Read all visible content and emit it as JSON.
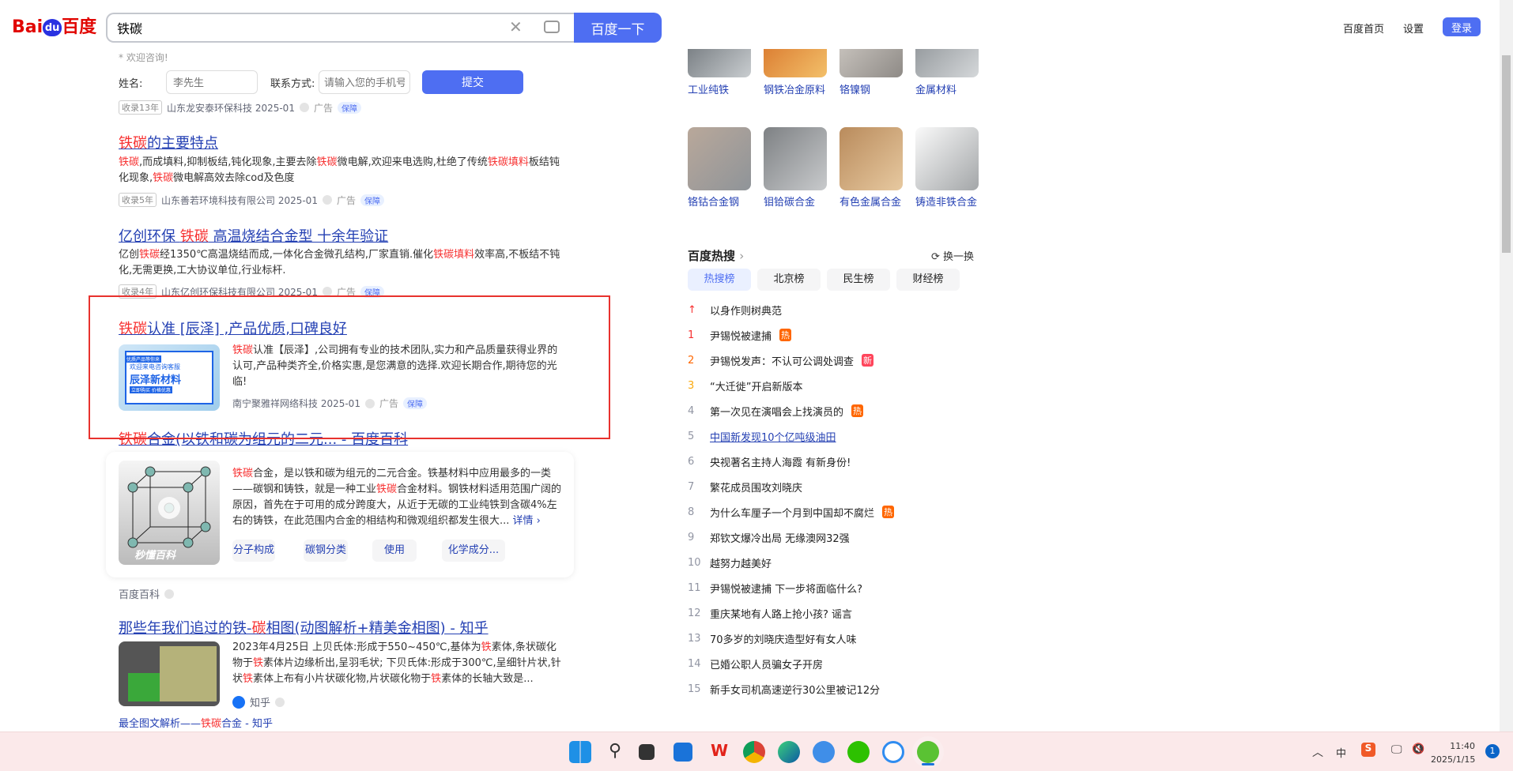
{
  "header": {
    "logo": "Bai度百度",
    "query": "铁碳",
    "search_button": "百度一下",
    "home": "百度首页",
    "settings": "设置",
    "login": "登录"
  },
  "ad_form": {
    "welcome": "* 欢迎咨询!",
    "name_label": "姓名:",
    "name_placeholder": "李先生",
    "contact_label": "联系方式:",
    "contact_placeholder": "请输入您的手机号",
    "submit": "提交",
    "meta_tag": "收录13年",
    "meta_source": "山东龙安泰环保科技 2025-01",
    "ad": "广告",
    "guarantee": "保障"
  },
  "results": [
    {
      "title_hl": "铁碳",
      "title_rest": "的主要特点",
      "desc": [
        {
          "h": "铁碳"
        },
        {
          "t": ",而成填料,抑制板结,钝化现象,主要去除"
        },
        {
          "h": "铁碳"
        },
        {
          "t": "微电解,欢迎来电选购,杜绝了传统"
        },
        {
          "h": "铁碳填料"
        },
        {
          "t": "板结钝化现象,"
        },
        {
          "h": "铁碳"
        },
        {
          "t": "微电解高效去除cod及色度"
        }
      ],
      "tag": "收录5年",
      "source": "山东善若环境科技有限公司 2025-01",
      "ad": "广告",
      "guarantee": "保障"
    },
    {
      "title_pre": "亿创环保 ",
      "title_hl": "铁碳",
      "title_rest": " 高温烧结合金型 十余年验证",
      "desc": [
        {
          "t": "亿创"
        },
        {
          "h": "铁碳"
        },
        {
          "t": "经1350℃高温烧结而成,一体化合金微孔结构,厂家直销.催化"
        },
        {
          "h": "铁碳填料"
        },
        {
          "t": "效率高,不板结不钝化,无需更换,工大协议单位,行业标杆."
        }
      ],
      "tag": "收录4年",
      "source": "山东亿创环保科技有限公司 2025-01",
      "ad": "广告",
      "guarantee": "保障"
    },
    {
      "title_hl": "铁碳",
      "title_rest": "认准 [辰泽] ,产品优质,口碑良好",
      "img_small": "优质产品等你来",
      "img_line1": "欢迎来电咨询客服",
      "img_line2": "辰泽新材料",
      "img_btn": "立即购买 价格优惠",
      "desc": [
        {
          "h": "铁碳"
        },
        {
          "t": "认准【辰泽】,公司拥有专业的技术团队,实力和产品质量获得业界的认可,产品种类齐全,价格实惠,是您满意的选择.欢迎长期合作,期待您的光临!"
        }
      ],
      "source": "南宁聚雅祥网络科技 2025-01",
      "ad": "广告",
      "guarantee": "保障"
    },
    {
      "title_hl": "铁碳",
      "title_rest": "合金(以铁和碳为组元的二元... - 百度百科",
      "img_label": "秒懂百科",
      "desc": [
        {
          "h": "铁碳"
        },
        {
          "t": "合金，是以铁和碳为组元的二元合金。铁基材料中应用最多的一类——碳钢和铸铁，就是一种工业"
        },
        {
          "h": "铁碳"
        },
        {
          "t": "合金材料。钢铁材料适用范围广阔的原因，首先在于可用的成分跨度大，从近于无碳的工业纯铁到含碳4%左右的铸铁，在此范围内合金的相结构和微观组织都发生很大..."
        }
      ],
      "more": "详情 ›",
      "tags": [
        "分子构成",
        "碳钢分类",
        "使用",
        "化学成分..."
      ],
      "source": "百度百科"
    },
    {
      "title_pre": "那些年我们追过的铁-",
      "title_hl": "碳",
      "title_rest": "相图(动图解析+精美金相图) - 知乎",
      "desc": [
        {
          "t": "2023年4月25日 上贝氏体:形成于550~450℃,基体为"
        },
        {
          "h": "铁"
        },
        {
          "t": "素体,条状碳化物于"
        },
        {
          "h": "铁"
        },
        {
          "t": "素体片边缘析出,呈羽毛状; 下贝氏体:形成于300℃,呈细针片状,针状"
        },
        {
          "h": "铁"
        },
        {
          "t": "素体上布有小片状碳化物,片状碳化物于"
        },
        {
          "h": "铁"
        },
        {
          "t": "素体的长轴大致是..."
        }
      ],
      "source": "知乎",
      "sub_pre": "最全图文解析——",
      "sub_hl": "铁碳",
      "sub_rest": "合金 - 知乎"
    }
  ],
  "right": {
    "grid": [
      "工业纯铁",
      "钢铁冶金原料",
      "铬镍钢",
      "金属材料",
      "铬钴合金钢",
      "钼铪碳合金",
      "有色金属合金",
      "铸造非铁合金"
    ],
    "hot_title": "百度热搜",
    "refresh": "换一换",
    "tabs": [
      "热搜榜",
      "北京榜",
      "民生榜",
      "财经榜"
    ],
    "items": [
      {
        "n": "↑",
        "t": "以身作则树典范"
      },
      {
        "n": "1",
        "t": "尹锡悦被逮捕",
        "b": "热"
      },
      {
        "n": "2",
        "t": "尹锡悦发声：不认可公调处调查",
        "b": "新"
      },
      {
        "n": "3",
        "t": "“大迁徙”开启新版本"
      },
      {
        "n": "4",
        "t": "第一次见在演唱会上找演员的",
        "b": "热"
      },
      {
        "n": "5",
        "t": "中国新发现10个亿吨级油田"
      },
      {
        "n": "6",
        "t": "央视著名主持人海霞 有新身份!"
      },
      {
        "n": "7",
        "t": "繁花成员围攻刘晓庆"
      },
      {
        "n": "8",
        "t": "为什么车厘子一个月到中国却不腐烂",
        "b": "热"
      },
      {
        "n": "9",
        "t": "郑钦文爆冷出局 无缘澳网32强"
      },
      {
        "n": "10",
        "t": "越努力越美好"
      },
      {
        "n": "11",
        "t": "尹锡悦被逮捕 下一步将面临什么?"
      },
      {
        "n": "12",
        "t": "重庆某地有人路上抢小孩? 谣言"
      },
      {
        "n": "13",
        "t": "70多岁的刘晓庆造型好有女人味"
      },
      {
        "n": "14",
        "t": "已婚公职人员骗女子开房"
      },
      {
        "n": "15",
        "t": "新手女司机高速逆行30公里被记12分"
      }
    ]
  },
  "taskbar": {
    "ime": "中",
    "time": "11:40",
    "date": "2025/1/15",
    "notif": "1"
  },
  "colors": {
    "accent": "#4e6ef2",
    "highlight": "#f73131",
    "link": "#2440b3",
    "taskbar": "#fbe9ea",
    "annotation": "#e8322e"
  }
}
